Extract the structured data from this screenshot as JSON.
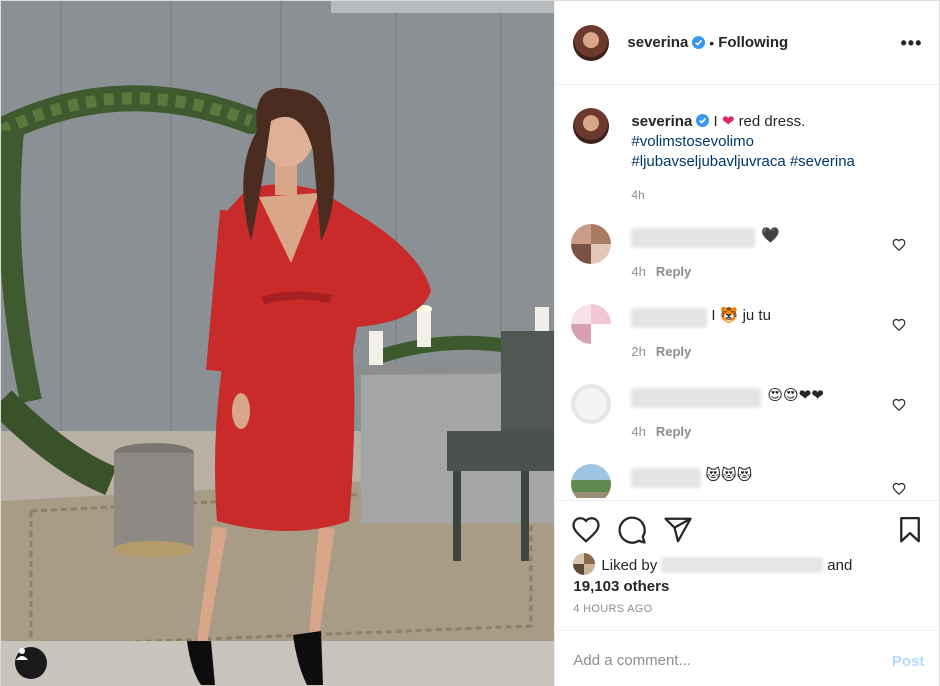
{
  "post": {
    "author": "severina",
    "verified": true,
    "follow_separator": "•",
    "follow_state": "Following",
    "more_icon": "more-horizontal-icon",
    "more_label": "•••"
  },
  "caption": {
    "username": "severina",
    "text_before": "I",
    "emoji": "❤",
    "text_after": "red dress.",
    "hashtags": [
      "#volimstosevolimo",
      "#ljubavseljubavljuvraca",
      "#severina"
    ],
    "time": "4h"
  },
  "comments": [
    {
      "text": "🖤",
      "time": "4h",
      "reply_label": "Reply"
    },
    {
      "text": "I 🐯 ju tu",
      "time": "2h",
      "reply_label": "Reply"
    },
    {
      "text": "😍😍❤❤",
      "time": "4h",
      "reply_label": "Reply"
    },
    {
      "text": "😻😻😻",
      "time": "",
      "reply_label": ""
    }
  ],
  "actions": {
    "like_icon": "heart-outline-icon",
    "comment_icon": "comment-bubble-icon",
    "share_icon": "paper-plane-icon",
    "save_icon": "bookmark-icon"
  },
  "likes": {
    "prefix": "Liked by",
    "conjunction": "and",
    "count_text": "19,103 others"
  },
  "timestamp": "4 HOURS AGO",
  "comment_box": {
    "placeholder": "Add a comment...",
    "post_label": "Post"
  },
  "colors": {
    "verified_blue": "#3897f0",
    "heart_red": "#e0245e",
    "hashtag_blue": "#00376b",
    "post_disabled": "#b3dbff",
    "dress_red": "#c92a2a"
  }
}
